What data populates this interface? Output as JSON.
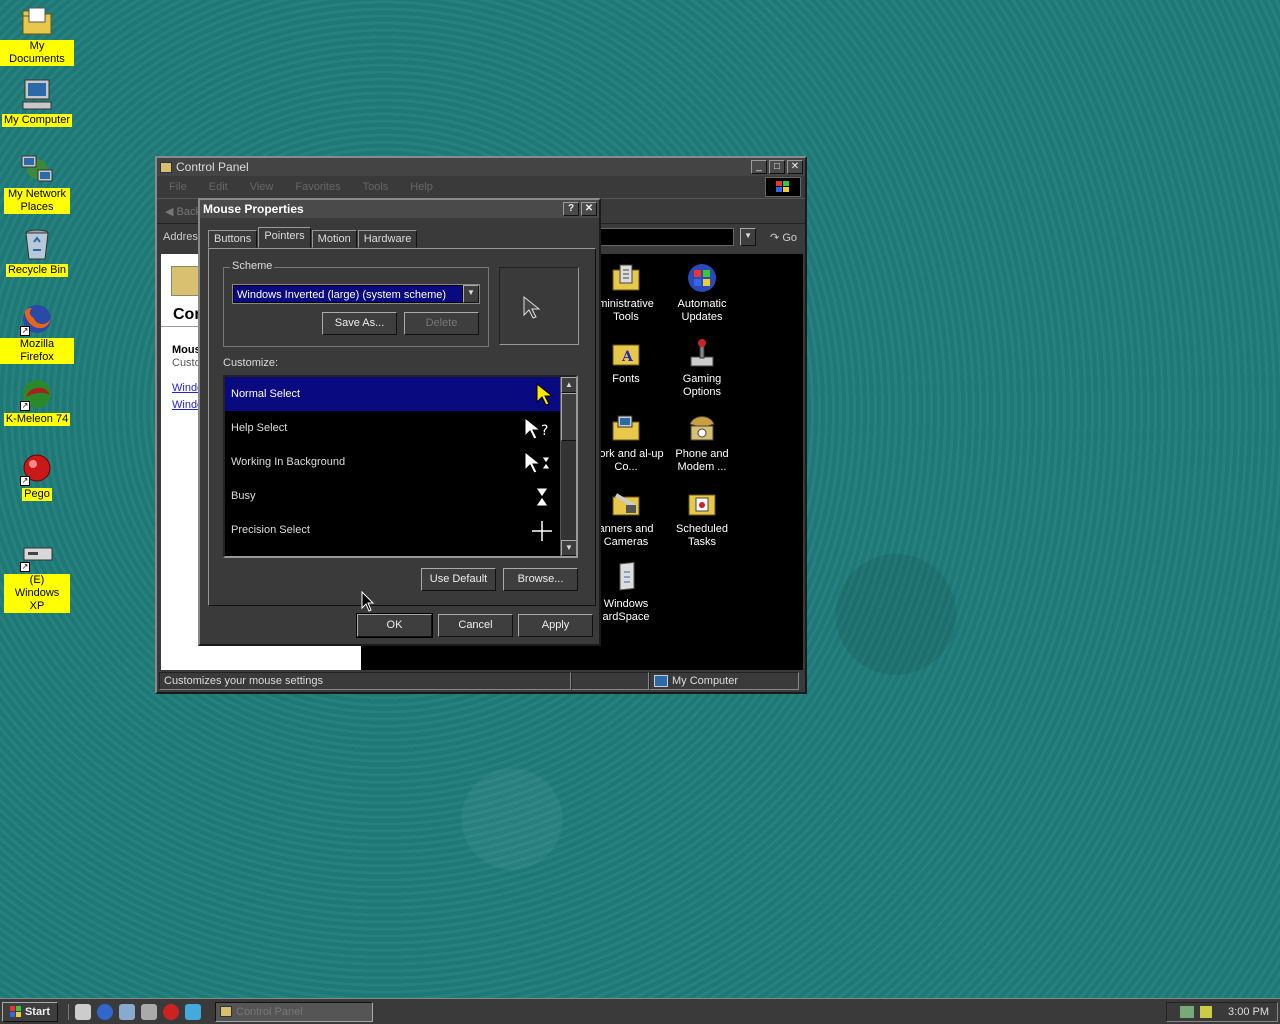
{
  "desktop_icons": [
    {
      "label": "My Documents",
      "icon": "folder-documents-icon",
      "shortcut": false
    },
    {
      "label": "My Computer",
      "icon": "computer-icon",
      "shortcut": false
    },
    {
      "label": "My Network Places",
      "icon": "network-icon",
      "shortcut": false
    },
    {
      "label": "Recycle Bin",
      "icon": "recycle-bin-icon",
      "shortcut": false
    },
    {
      "label": "Mozilla Firefox",
      "icon": "firefox-icon",
      "shortcut": true
    },
    {
      "label": "K-Meleon 74",
      "icon": "kmeleon-icon",
      "shortcut": true
    },
    {
      "label": "Pego",
      "icon": "pego-icon",
      "shortcut": true
    },
    {
      "label": "(E) Windows XP",
      "icon": "drive-icon",
      "shortcut": true
    }
  ],
  "control_panel": {
    "title": "Control Panel",
    "menu": [
      "File",
      "Edit",
      "View",
      "Favorites",
      "Tools",
      "Help"
    ],
    "back_label": "Back",
    "address_label": "Address",
    "go_label": "Go",
    "left_title": "Cor",
    "left_heading": "Mous",
    "left_sub": "Custo",
    "left_links": [
      "Windo",
      "Windo"
    ],
    "items": [
      {
        "label": "ministrative Tools",
        "icon": "admin-tools-icon"
      },
      {
        "label": "Automatic Updates",
        "icon": "automatic-updates-icon"
      },
      {
        "label": "Fonts",
        "icon": "fonts-folder-icon"
      },
      {
        "label": "Gaming Options",
        "icon": "joystick-icon"
      },
      {
        "label": "twork and al-up Co...",
        "icon": "network-connections-icon"
      },
      {
        "label": "Phone and Modem ...",
        "icon": "phone-icon"
      },
      {
        "label": "anners and Cameras",
        "icon": "scanner-icon"
      },
      {
        "label": "Scheduled Tasks",
        "icon": "scheduled-tasks-icon"
      },
      {
        "label": "Windows ardSpace",
        "icon": "cardspace-icon"
      }
    ],
    "status_text": "Customizes your mouse settings",
    "status_zone": "My Computer"
  },
  "mouse_properties": {
    "title": "Mouse Properties",
    "help_btn": "?",
    "close_btn": "✕",
    "tabs": [
      "Buttons",
      "Pointers",
      "Motion",
      "Hardware"
    ],
    "active_tab": "Pointers",
    "scheme_label": "Scheme",
    "scheme_value": "Windows Inverted (large) (system scheme)",
    "save_as_label": "Save As...",
    "delete_label": "Delete",
    "customize_label": "Customize:",
    "pointers": [
      {
        "name": "Normal Select",
        "glyph": "▶"
      },
      {
        "name": "Help Select",
        "glyph": "?"
      },
      {
        "name": "Working In Background",
        "glyph": "⧗"
      },
      {
        "name": "Busy",
        "glyph": "⧗"
      },
      {
        "name": "Precision Select",
        "glyph": "+"
      }
    ],
    "selected_pointer": "Normal Select",
    "use_default_label": "Use Default",
    "browse_label": "Browse...",
    "ok_label": "OK",
    "cancel_label": "Cancel",
    "apply_label": "Apply"
  },
  "taskbar": {
    "start_label": "Start",
    "task_button_label": "Control Panel",
    "clock": "3:00 PM"
  }
}
